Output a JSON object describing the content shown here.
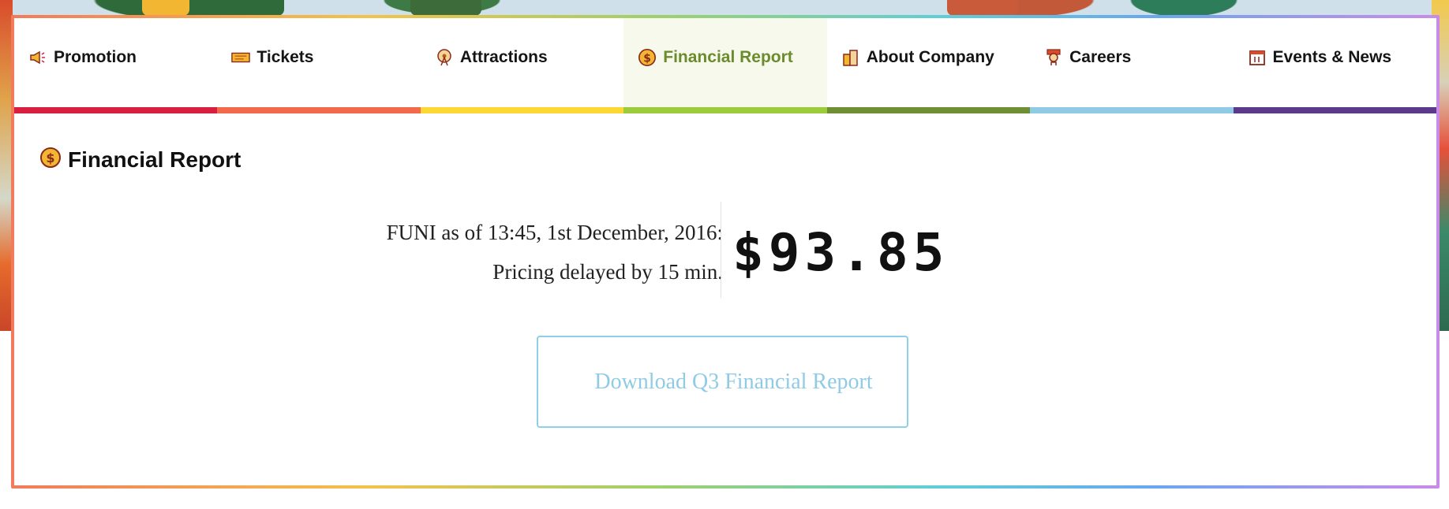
{
  "colors": {
    "promotion": "#d81f3f",
    "tickets": "#f26a4b",
    "attractions": "#fdd835",
    "financial_report": "#9ccc3c",
    "about_company": "#6f8f35",
    "careers": "#8fcbe4",
    "events_news": "#5b3a8c",
    "active_text": "#6b8b2d",
    "button_text": "#8fcbe4"
  },
  "tabs": [
    {
      "label": "Promotion",
      "icon": "megaphone-icon",
      "active": false
    },
    {
      "label": "Tickets",
      "icon": "ticket-icon",
      "active": false
    },
    {
      "label": "Attractions",
      "icon": "ferris-wheel-icon",
      "active": false
    },
    {
      "label": "Financial Report",
      "icon": "dollar-coin-icon",
      "active": true
    },
    {
      "label": "About Company",
      "icon": "building-icon",
      "active": false
    },
    {
      "label": "Careers",
      "icon": "person-icon",
      "active": false
    },
    {
      "label": "Events & News",
      "icon": "calendar-icon",
      "active": false
    }
  ],
  "section": {
    "title": "Financial Report",
    "icon": "dollar-coin-icon"
  },
  "stock": {
    "as_of": "FUNI as of 13:45, 1st December, 2016:",
    "delay_note": "Pricing delayed by 15 min.",
    "price": "$93.85"
  },
  "download": {
    "label": "Download Q3 Financial Report"
  }
}
